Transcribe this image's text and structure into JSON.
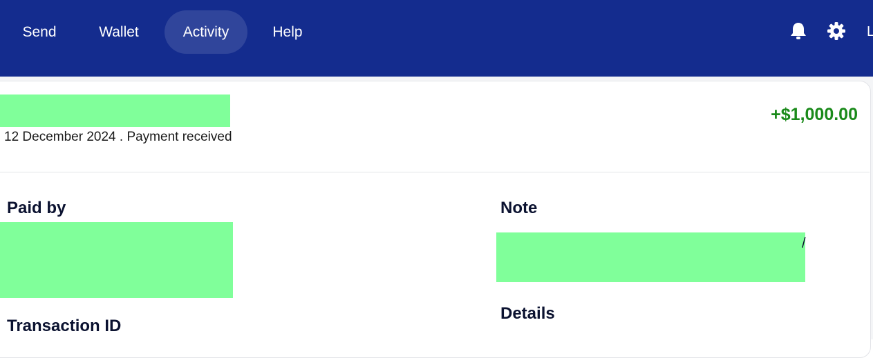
{
  "nav": {
    "items": [
      {
        "label": "Send"
      },
      {
        "label": "Wallet"
      },
      {
        "label": "Activity"
      },
      {
        "label": "Help"
      }
    ],
    "user_initial": "L"
  },
  "transaction": {
    "meta": "12 December 2024 . Payment received",
    "amount": "+$1,000.00",
    "paid_by_label": "Paid by",
    "transaction_id_label": "Transaction ID",
    "note_label": "Note",
    "details_label": "Details",
    "note_tail": "/"
  },
  "colors": {
    "nav_bg": "#142c8e",
    "amount_positive": "#1a8a1a",
    "redaction": "#80ff9a"
  },
  "icons": {
    "notifications": "bell-icon",
    "settings": "gear-icon"
  }
}
